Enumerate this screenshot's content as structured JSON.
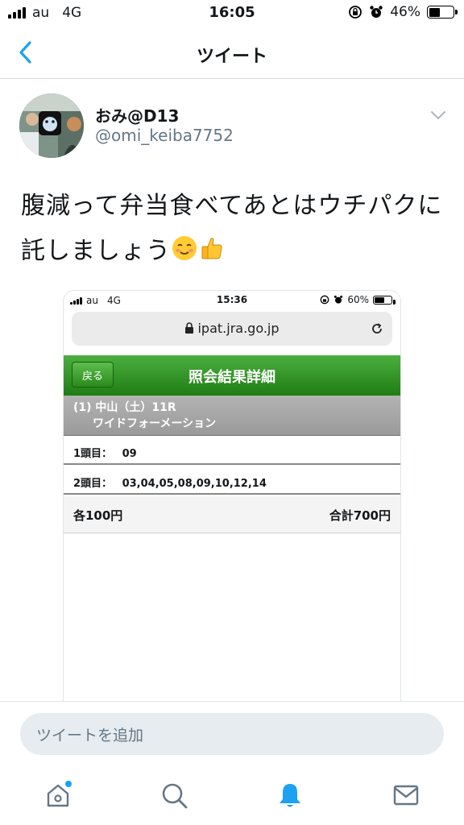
{
  "status_bar": {
    "carrier": "au",
    "network": "4G",
    "time": "16:05",
    "battery": "46%",
    "battery_level": 0.46
  },
  "nav": {
    "title": "ツイート",
    "back_icon": "chevron-left-icon"
  },
  "tweet": {
    "author_name": "おみ@D13",
    "handle": "@omi_keiba7752",
    "text": "腹減って弁当食べてあとはウチパクに託しましょう",
    "emojis": [
      "smiling-face-emoji",
      "thumbs-up-emoji"
    ]
  },
  "embedded_screenshot": {
    "status_bar": {
      "carrier": "au",
      "network": "4G",
      "time": "15:36",
      "battery": "60%",
      "battery_level": 0.6
    },
    "url": "ipat.jra.go.jp",
    "back_label": "戻る",
    "title": "照会結果詳細",
    "race_line1": "(1) 中山（土）11R",
    "race_line2": "ワイドフォーメーション",
    "rows": [
      {
        "label": "1頭目：",
        "value": "09"
      },
      {
        "label": "2頭目：",
        "value": "03,04,05,08,09,10,12,14"
      }
    ],
    "unit_price": "各100円",
    "total": "合計700円"
  },
  "compose": {
    "placeholder": "ツイートを追加"
  },
  "tab_bar": {
    "items": [
      "home-icon",
      "search-icon",
      "notifications-icon",
      "messages-icon"
    ],
    "accent": "#1da1f2"
  }
}
